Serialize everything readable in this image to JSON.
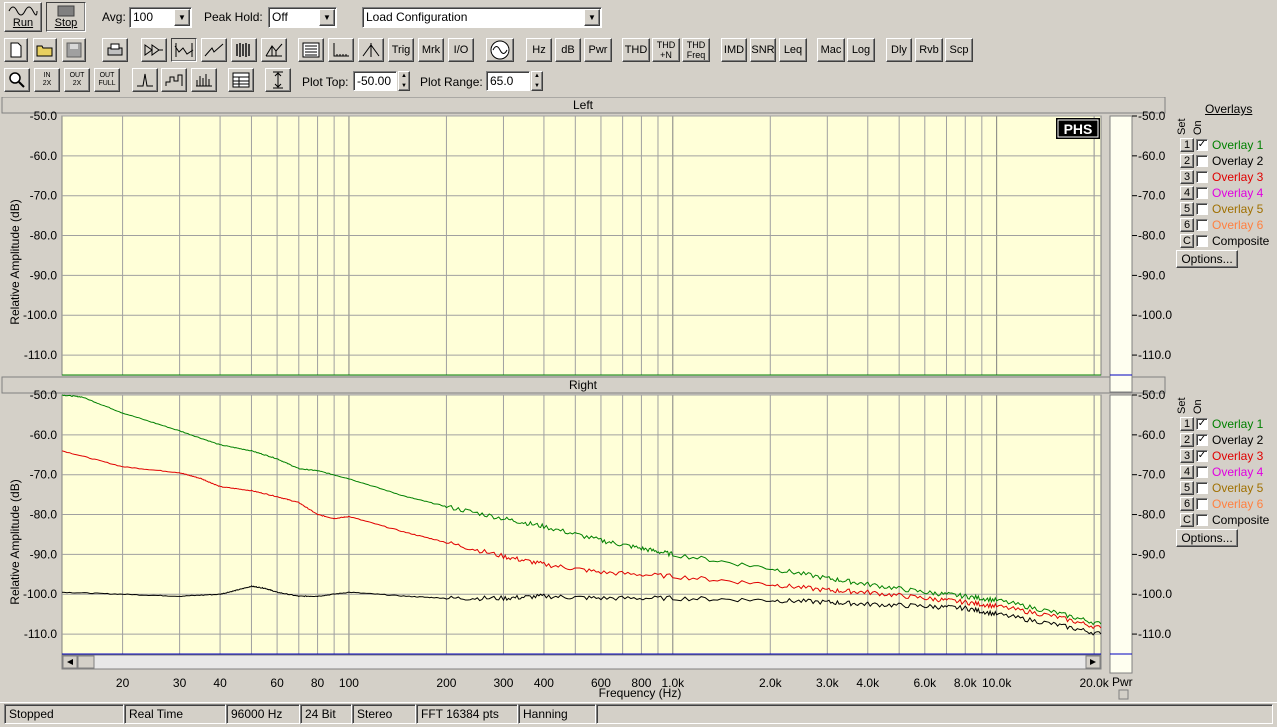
{
  "toolbar_top": {
    "run_label": "Run",
    "stop_label": "Stop",
    "avg_label": "Avg:",
    "avg_value": "100",
    "peak_hold_label": "Peak Hold:",
    "peak_hold_value": "Off",
    "config_value": "Load Configuration"
  },
  "toolbar_buttons": [
    "Trig",
    "Mrk",
    "I/O",
    "Hz",
    "dB",
    "Pwr",
    "THD",
    "THD +N",
    "THD Freq",
    "IMD",
    "SNR",
    "Leq",
    "Mac",
    "Log",
    "Dly",
    "Rvb",
    "Scp"
  ],
  "toolbar_zoom": {
    "zoom_in_label": "IN 2X",
    "zoom_out_label": "OUT 2X",
    "zoom_full_label": "OUT FULL",
    "plot_top_label": "Plot Top:",
    "plot_top_value": "-50.00",
    "plot_range_label": "Plot Range:",
    "plot_range_value": "65.0"
  },
  "logo": "PHS",
  "panels": [
    {
      "title": "Left",
      "ylabel": "Relative Amplitude (dB)",
      "overlays_title": "Overlays",
      "set_header": "Set",
      "on_header": "On",
      "overlays": [
        {
          "set": "1",
          "name": "Overlay 1",
          "on": true,
          "color": "#008000"
        },
        {
          "set": "2",
          "name": "Overlay 2",
          "on": false,
          "color": "#000000"
        },
        {
          "set": "3",
          "name": "Overlay 3",
          "on": false,
          "color": "#e00000"
        },
        {
          "set": "4",
          "name": "Overlay 4",
          "on": false,
          "color": "#e000e0"
        },
        {
          "set": "5",
          "name": "Overlay 5",
          "on": false,
          "color": "#a07000"
        },
        {
          "set": "6",
          "name": "Overlay 6",
          "on": false,
          "color": "#ff8040"
        },
        {
          "set": "C",
          "name": "Composite",
          "on": false,
          "color": "#000000"
        }
      ],
      "options_label": "Options..."
    },
    {
      "title": "Right",
      "ylabel": "Relative Amplitude (dB)",
      "overlays_title": "",
      "set_header": "Set",
      "on_header": "On",
      "overlays": [
        {
          "set": "1",
          "name": "Overlay 1",
          "on": true,
          "color": "#008000"
        },
        {
          "set": "2",
          "name": "Overlay 2",
          "on": true,
          "color": "#000000"
        },
        {
          "set": "3",
          "name": "Overlay 3",
          "on": true,
          "color": "#e00000"
        },
        {
          "set": "4",
          "name": "Overlay 4",
          "on": false,
          "color": "#e000e0"
        },
        {
          "set": "5",
          "name": "Overlay 5",
          "on": false,
          "color": "#a07000"
        },
        {
          "set": "6",
          "name": "Overlay 6",
          "on": false,
          "color": "#ff8040"
        },
        {
          "set": "C",
          "name": "Composite",
          "on": false,
          "color": "#000000"
        }
      ],
      "options_label": "Options..."
    }
  ],
  "chart_data": [
    {
      "type": "line",
      "title": "Left",
      "ylabel": "Relative Amplitude (dB)",
      "xlabel": "",
      "x_scale": "log",
      "xlim": [
        13,
        21000
      ],
      "ylim": [
        -115,
        -50
      ],
      "yticks": [
        -50,
        -60,
        -70,
        -80,
        -90,
        -100,
        -110
      ],
      "ytick_labels": [
        "-50.0",
        "-60.0",
        "-70.0",
        "-80.0",
        "-90.0",
        "-100.0",
        "-110.0"
      ],
      "grid": true,
      "series": [
        {
          "name": "Overlay 1",
          "color": "#008000",
          "x": [
            13,
            21000
          ],
          "y": [
            -115,
            -115
          ]
        }
      ]
    },
    {
      "type": "line",
      "title": "Right",
      "ylabel": "Relative Amplitude (dB)",
      "xlabel": "Frequency (Hz)",
      "x_scale": "log",
      "xlim": [
        13,
        21000
      ],
      "ylim": [
        -115,
        -50
      ],
      "yticks": [
        -50,
        -60,
        -70,
        -80,
        -90,
        -100,
        -110
      ],
      "ytick_labels": [
        "-50.0",
        "-60.0",
        "-70.0",
        "-80.0",
        "-90.0",
        "-100.0",
        "-110.0"
      ],
      "xticks": [
        20,
        30,
        40,
        60,
        80,
        100,
        200,
        300,
        400,
        600,
        800,
        1000,
        2000,
        3000,
        4000,
        6000,
        8000,
        10000,
        20000
      ],
      "xtick_labels": [
        "20",
        "30",
        "40",
        "60",
        "80",
        "100",
        "200",
        "300",
        "400",
        "600",
        "800",
        "1.0k",
        "2.0k",
        "3.0k",
        "4.0k",
        "6.0k",
        "8.0k",
        "10.0k",
        "20.0k"
      ],
      "grid": true,
      "series": [
        {
          "name": "Overlay 1",
          "color": "#008000",
          "x": [
            13,
            15,
            20,
            30,
            40,
            50,
            60,
            70,
            80,
            100,
            150,
            200,
            300,
            400,
            600,
            800,
            1000,
            2000,
            3000,
            4000,
            6000,
            8000,
            10000,
            15000,
            21000
          ],
          "y": [
            -50,
            -50.5,
            -54.5,
            -59,
            -62.5,
            -64,
            -66,
            -68.5,
            -69,
            -71,
            -75.5,
            -78,
            -81,
            -83,
            -86.5,
            -88.5,
            -90,
            -93.5,
            -96,
            -97.5,
            -99.5,
            -100.5,
            -101.5,
            -104.5,
            -107.5
          ]
        },
        {
          "name": "Overlay 2",
          "color": "#000000",
          "x": [
            13,
            20,
            30,
            40,
            45,
            50,
            55,
            60,
            70,
            80,
            100,
            150,
            200,
            300,
            400,
            600,
            1000,
            2000,
            3000,
            4000,
            6000,
            8000,
            10000,
            15000,
            21000
          ],
          "y": [
            -99.5,
            -100,
            -100.5,
            -100,
            -99,
            -98,
            -98.5,
            -99.5,
            -100.5,
            -100.5,
            -99.5,
            -100.5,
            -101,
            -101,
            -100.5,
            -101,
            -101,
            -101.5,
            -102,
            -102.5,
            -103,
            -103.5,
            -105,
            -107.5,
            -110
          ]
        },
        {
          "name": "Overlay 3",
          "color": "#e00000",
          "x": [
            13,
            20,
            30,
            35,
            40,
            50,
            60,
            70,
            80,
            90,
            100,
            150,
            200,
            300,
            400,
            600,
            1000,
            2000,
            3000,
            4000,
            6000,
            8000,
            10000,
            15000,
            21000
          ],
          "y": [
            -64,
            -68,
            -69.5,
            -71,
            -73,
            -74,
            -75.5,
            -77,
            -80,
            -81,
            -80.5,
            -84.5,
            -87,
            -90.5,
            -92.5,
            -94.5,
            -95.5,
            -97.5,
            -99,
            -99.5,
            -101,
            -102,
            -103,
            -105.5,
            -108.5
          ]
        },
        {
          "name": "baseline",
          "color": "#0000c0",
          "x": [
            13,
            21000
          ],
          "y": [
            -115,
            -115
          ]
        }
      ]
    }
  ],
  "right_scale": {
    "ytick_labels": [
      "-50.0",
      "-60.0",
      "-70.0",
      "-80.0",
      "-90.0",
      "-100.0",
      "-110.0"
    ],
    "pwr_label": "Pwr"
  },
  "status_bar": [
    "Stopped",
    "Real Time",
    "96000 Hz",
    "24 Bit",
    "Stereo",
    "FFT 16384 pts",
    "Hanning"
  ]
}
